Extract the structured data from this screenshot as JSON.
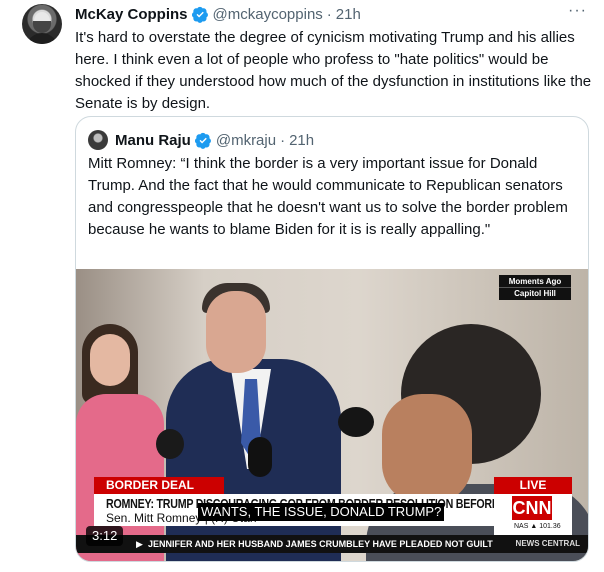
{
  "tweet": {
    "author_name": "McKay Coppins",
    "handle": "@mckaycoppins",
    "separator": "·",
    "time": "21h",
    "more_label": "···",
    "text": "It's hard to overstate the degree of cynicism motivating Trump and his allies here. I think even a lot of people who profess to \"hate politics\" would be shocked if they understood how much of the dysfunction in institutions like the Senate is by design.",
    "verified_color": "#1d9bf0"
  },
  "quote": {
    "author_name": "Manu Raju",
    "handle": "@mkraju",
    "separator": "·",
    "time": "21h",
    "text": "Mitt Romney: “I think the border is a very important issue for Donald Trump. And the fact that he would communicate to Republican senators and congresspeople that he doesn't want us to solve the border problem because he wants to blame Biden for it is is really appalling.\""
  },
  "video": {
    "moments_line1": "Moments Ago",
    "moments_line2": "Capitol Hill",
    "banner_left": "BORDER DEAL",
    "banner_live": "LIVE",
    "headline": "ROMNEY: TRUMP DISCOURAGING GOP FROM BORDER RESOLUTION BEFORE ELECTION",
    "subline": "Sen. Mitt Romney  |  (R) Utah",
    "caption": "WANTS, THE ISSUE, DONALD TRUMP?",
    "network_logo": "CNN",
    "market": "NAS ▲ 101.36",
    "ticker_arrow": "▶",
    "ticker": "JENNIFER AND HER HUSBAND JAMES CRUMBLEY HAVE PLEADED NOT GUILT",
    "ticker_brand": "NEWS CENTRAL",
    "duration": "3:12",
    "cnn_red": "#cc0000"
  }
}
